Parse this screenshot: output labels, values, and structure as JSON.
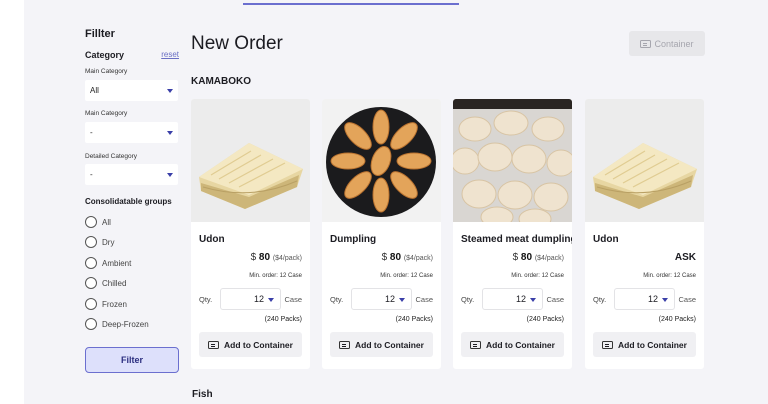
{
  "sidebar": {
    "title": "Fillter",
    "category_label": "Category",
    "reset_label": "reset",
    "main_category_label_1": "Main Category",
    "main_category_value_1": "All",
    "main_category_label_2": "Main Category",
    "main_category_value_2": "-",
    "detailed_category_label": "Detailed Category",
    "detailed_category_value": "-",
    "groups_label": "Consolidatable groups",
    "groups": [
      "All",
      "Dry",
      "Ambient",
      "Chilled",
      "Frozen",
      "Deep-Frozen"
    ],
    "filter_button": "Filter"
  },
  "header": {
    "title": "New Order",
    "container_button": "Container"
  },
  "sections": {
    "kamaboko": "KAMABOKO",
    "fish": "Fish"
  },
  "products": [
    {
      "name": "Udon",
      "currency": "$",
      "price": "80",
      "unit_price": "($4/pack)",
      "min_order": "Min. order: 12 Case",
      "qty_label": "Qty.",
      "qty": "12",
      "case": "Case",
      "packs": "(240 Packs)",
      "add_label": "Add to Container",
      "image": "udon"
    },
    {
      "name": "Dumpling",
      "currency": "$",
      "price": "80",
      "unit_price": "($4/pack)",
      "min_order": "Min. order: 12 Case",
      "qty_label": "Qty.",
      "qty": "12",
      "case": "Case",
      "packs": "(240 Packs)",
      "add_label": "Add to Container",
      "image": "dumpling"
    },
    {
      "name": "Steamed meat dumpling",
      "currency": "$",
      "price": "80",
      "unit_price": "($4/pack)",
      "min_order": "Min. order: 12 Case",
      "qty_label": "Qty.",
      "qty": "12",
      "case": "Case",
      "packs": "(240 Packs)",
      "add_label": "Add to Container",
      "image": "steamed-dumpling"
    },
    {
      "name": "Udon",
      "ask": "ASK",
      "min_order": "Min. order: 12 Case",
      "qty_label": "Qty.",
      "qty": "12",
      "case": "Case",
      "packs": "(240 Packs)",
      "add_label": "Add to Container",
      "image": "udon"
    }
  ],
  "colors": {
    "accent": "#6b6fcf",
    "background": "#f4f4f8",
    "filter_button_bg": "#dde0fb"
  }
}
